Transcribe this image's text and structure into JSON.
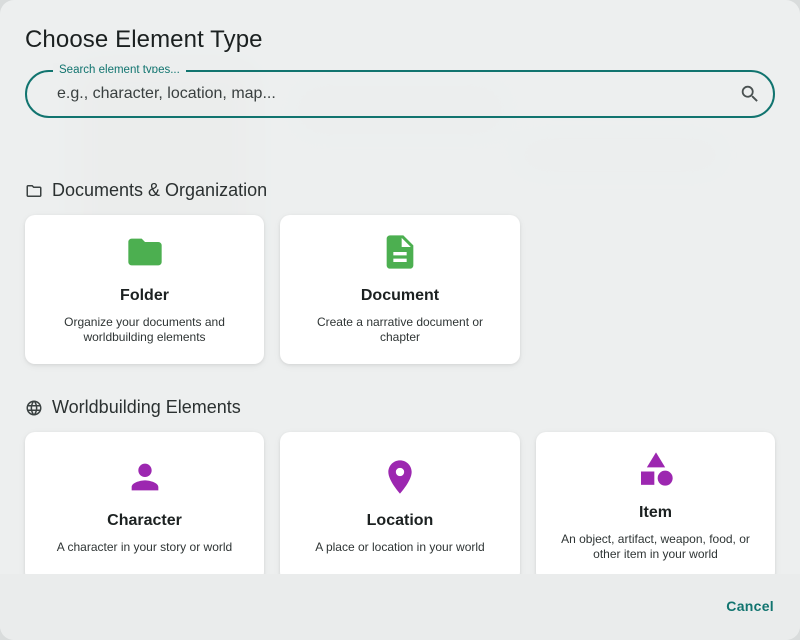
{
  "dialog": {
    "title": "Choose Element Type",
    "search": {
      "label": "Search element types...",
      "placeholder": "e.g., character, location, map...",
      "value": ""
    },
    "cancel_label": "Cancel"
  },
  "sections": [
    {
      "title": "Documents & Organization",
      "icon": "folder-outline-icon",
      "cards": [
        {
          "title": "Folder",
          "description": "Organize your documents and worldbuilding elements",
          "icon": "folder-icon",
          "color": "#4caf50"
        },
        {
          "title": "Document",
          "description": "Create a narrative document or chapter",
          "icon": "document-icon",
          "color": "#4caf50"
        }
      ]
    },
    {
      "title": "Worldbuilding Elements",
      "icon": "globe-icon",
      "cards": [
        {
          "title": "Character",
          "description": "A character in your story or world",
          "icon": "person-icon",
          "color": "#9c27b0"
        },
        {
          "title": "Location",
          "description": "A place or location in your world",
          "icon": "location-pin-icon",
          "color": "#9c27b0"
        },
        {
          "title": "Item",
          "description": "An object, artifact, weapon, food, or other item in your world",
          "icon": "shapes-icon",
          "color": "#9c27b0"
        }
      ]
    }
  ],
  "colors": {
    "accent": "#11746f",
    "green": "#4caf50",
    "purple": "#9c27b0"
  }
}
